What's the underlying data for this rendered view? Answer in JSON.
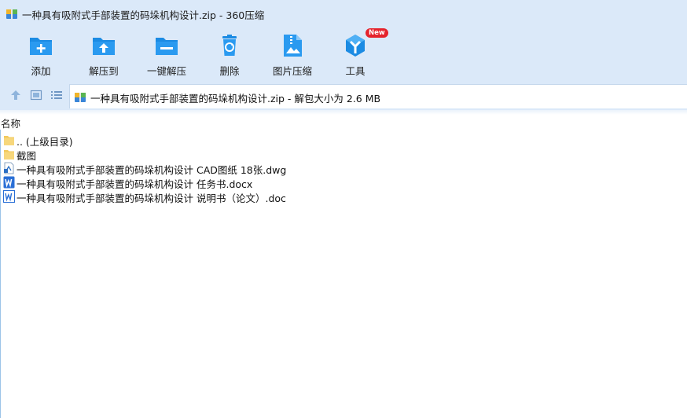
{
  "window": {
    "title": "一种具有吸附式手部装置的码垛机构设计.zip - 360压缩"
  },
  "toolbar": {
    "buttons": [
      {
        "label": "添加",
        "icon": "add-folder-icon"
      },
      {
        "label": "解压到",
        "icon": "extract-to-icon"
      },
      {
        "label": "一键解压",
        "icon": "one-click-extract-icon"
      },
      {
        "label": "删除",
        "icon": "recycle-bin-icon"
      },
      {
        "label": "图片压缩",
        "icon": "image-compress-icon"
      },
      {
        "label": "工具",
        "icon": "tools-icon",
        "badge": "New"
      }
    ]
  },
  "address": {
    "path": "一种具有吸附式手部装置的码垛机构设计.zip - 解包大小为 2.6 MB"
  },
  "list": {
    "column_name": "名称",
    "items": [
      {
        "name": ".. (上级目录)",
        "icon": "folder-icon"
      },
      {
        "name": "截图",
        "icon": "folder-icon"
      },
      {
        "name": "一种具有吸附式手部装置的码垛机构设计 CAD图纸 18张.dwg",
        "icon": "dwg-file-icon"
      },
      {
        "name": "一种具有吸附式手部装置的码垛机构设计 任务书.docx",
        "icon": "docx-file-icon"
      },
      {
        "name": "一种具有吸附式手部装置的码垛机构设计 说明书（论文）.doc",
        "icon": "doc-file-icon"
      }
    ]
  },
  "colors": {
    "toolbar_bg": "#dbe9f9",
    "icon_blue": "#1b8be3",
    "badge_red": "#e5232c"
  }
}
